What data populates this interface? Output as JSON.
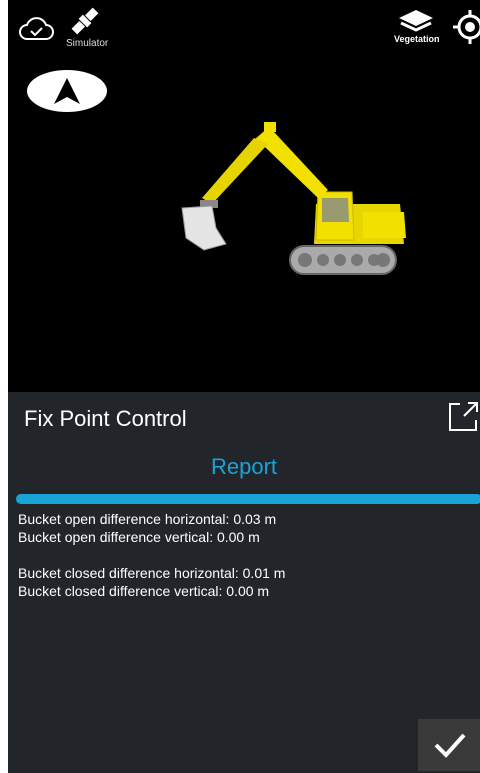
{
  "viewport": {
    "simulator_label": "Simulator",
    "layers_label": "Vegetation",
    "icons": [
      "cloud-check-icon",
      "satellite-icon",
      "navigation-arrow-icon",
      "layers-icon",
      "gps-target-icon"
    ],
    "machine": "excavator"
  },
  "panel": {
    "title": "Fix Point Control",
    "report_title": "Report",
    "progress": 1.0,
    "lines": [
      "Bucket open difference horizontal: 0.03 m",
      "Bucket open difference vertical: 0.00 m",
      "Bucket closed difference horizontal: 0.01 m",
      "Bucket closed difference vertical: 0.00 m"
    ]
  },
  "colors": {
    "accent": "#1aa3d6",
    "panel_bg": "#22262a",
    "machine_yellow": "#f2e000"
  }
}
